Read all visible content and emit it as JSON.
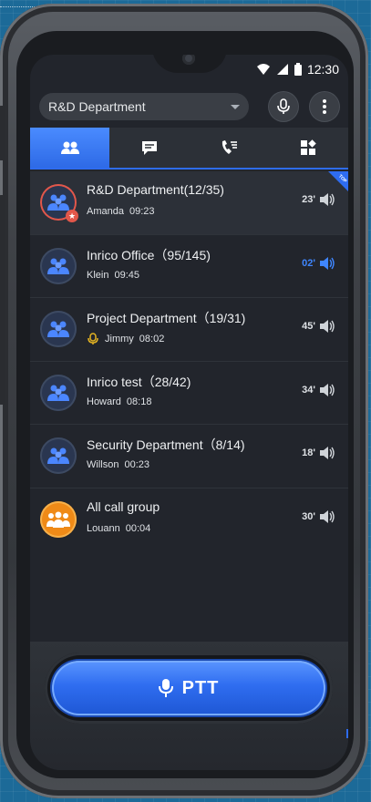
{
  "status": {
    "time": "12:30"
  },
  "header": {
    "department": "R&D Department"
  },
  "tabs": [
    {
      "icon": "groups-icon",
      "active": true
    },
    {
      "icon": "message-icon",
      "active": false
    },
    {
      "icon": "call-log-icon",
      "active": false
    },
    {
      "icon": "apps-icon",
      "active": false
    }
  ],
  "groups": [
    {
      "title": "R&D Department(12/35)",
      "user": "Amanda",
      "time": "09:23",
      "duration": "23'",
      "selected": true
    },
    {
      "title": "Inrico Office（95/145)",
      "user": "Klein",
      "time": "09:45",
      "duration": "02'",
      "active_audio": true
    },
    {
      "title": "Project Department（19/31)",
      "user": "Jimmy",
      "time": "08:02",
      "duration": "45'"
    },
    {
      "title": "Inrico test（28/42)",
      "user": "Howard",
      "time": "08:18",
      "duration": "34'"
    },
    {
      "title": "Security Department（8/14)",
      "user": "Willson",
      "time": "00:23",
      "duration": "18'"
    },
    {
      "title": "All call group",
      "user": "Louann",
      "time": "00:04",
      "duration": "30'"
    }
  ],
  "badge": {
    "text": "TOP"
  },
  "ptt": {
    "label": "PTT"
  },
  "colors": {
    "accent": "#2e6cf0",
    "active_audio": "#3f86ff",
    "all_call": "#ef8a17",
    "selected_ring": "#e2574a"
  }
}
